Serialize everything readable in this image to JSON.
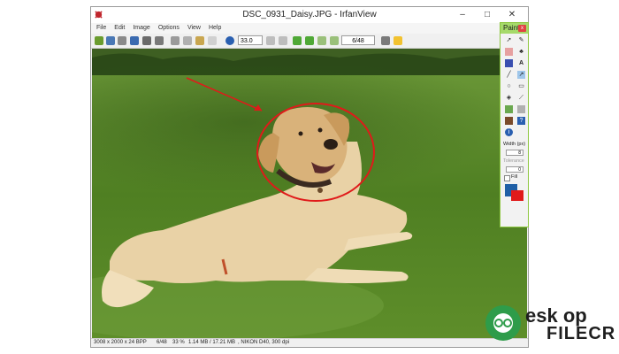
{
  "window": {
    "title": "DSC_0931_Daisy.JPG - IrfanView",
    "controls": {
      "minimize": "–",
      "maximize": "□",
      "close": "✕"
    }
  },
  "menu": [
    "File",
    "Edit",
    "Image",
    "Options",
    "View",
    "Help"
  ],
  "toolbar": {
    "zoom_value": "33.0",
    "page_value": "6/48",
    "icons": [
      "open-folder-icon",
      "copy-icon",
      "slideshow-icon",
      "save-icon",
      "print-icon",
      "trash-icon",
      "cut-icon",
      "copy-icon",
      "paste-icon",
      "undo-icon",
      "info-icon",
      "zoom-in-icon",
      "zoom-out-icon",
      "prev-icon",
      "next-icon",
      "first-icon",
      "last-icon",
      "settings-icon",
      "star-icon"
    ]
  },
  "status": {
    "dimensions": "3008 x 2000 x 24 BPP",
    "page": "6/48",
    "zoom": "33 %",
    "size": "1.14 MB / 17.21 MB",
    "camera": ", NIKON D40, 300 dpi"
  },
  "paint": {
    "title": "Paint",
    "close": "x",
    "width_label": "Width (px)",
    "width_value": "8",
    "tolerance_label": "Tolerance",
    "tolerance_value": "0",
    "fill_label": "Fill",
    "colors": {
      "primary": "#1f5fa6",
      "secondary": "#e01a1a"
    }
  },
  "annotation_colors": {
    "ellipse": "#e01a1a",
    "arrow": "#e01a1a"
  },
  "watermark": {
    "line1": "esk op",
    "line2": "FILECR"
  }
}
